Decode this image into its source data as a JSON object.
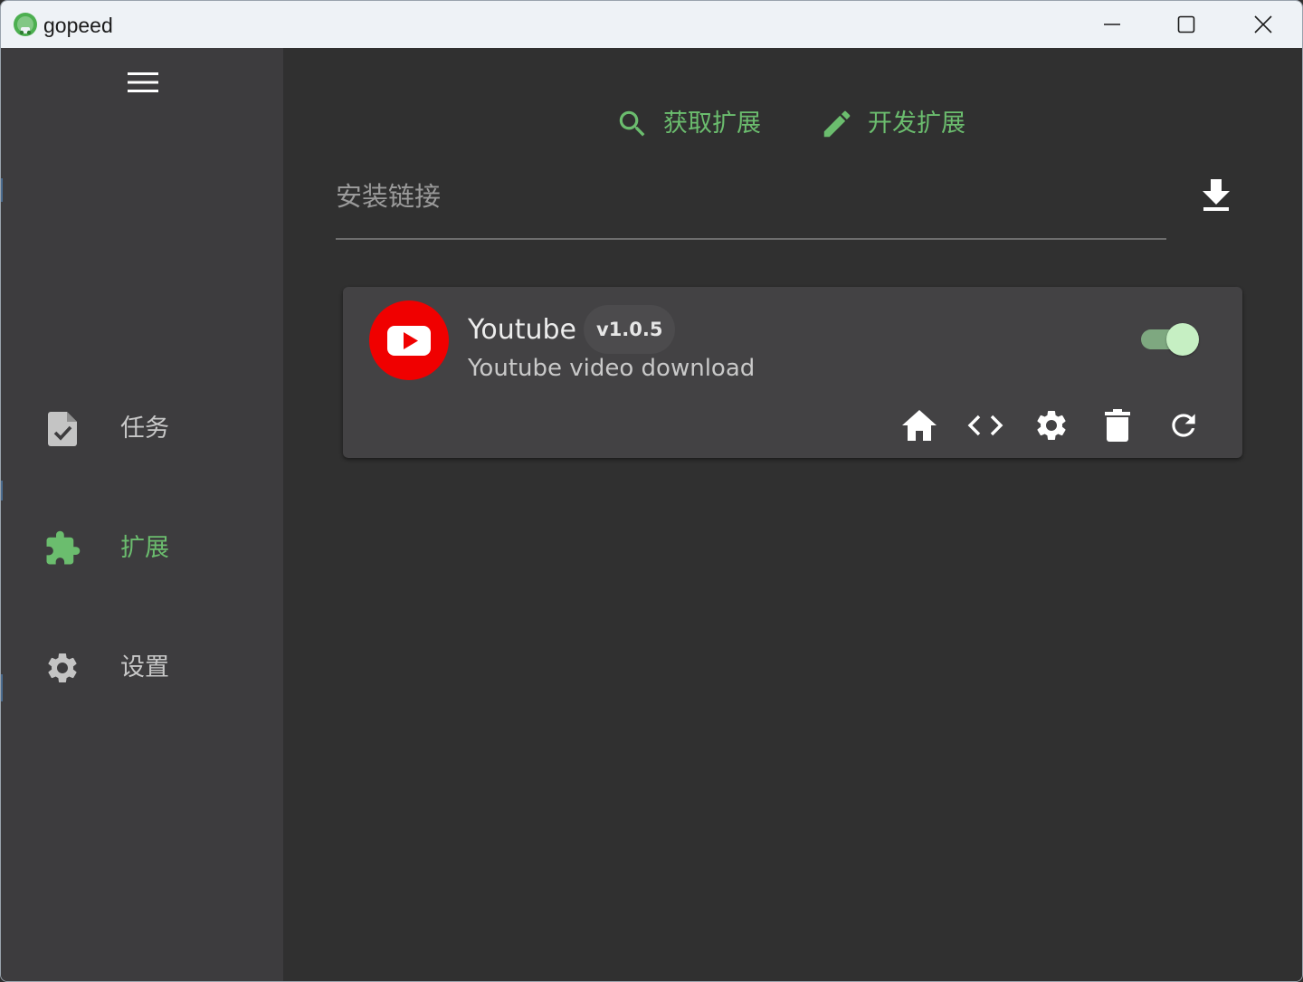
{
  "window": {
    "title": "gopeed",
    "logo_icon": "gopeed-logo-icon",
    "controls": [
      "minimize-icon",
      "maximize-icon",
      "close-icon"
    ]
  },
  "sidebar": {
    "menu_icon": "hamburger-menu-icon",
    "items": [
      {
        "label": "任务",
        "icon": "task-file-check-icon",
        "active": false
      },
      {
        "label": "扩展",
        "icon": "puzzle-extension-icon",
        "active": true
      },
      {
        "label": "设置",
        "icon": "gear-icon",
        "active": false
      }
    ]
  },
  "main": {
    "actions": [
      {
        "label": "获取扩展",
        "icon": "search-icon"
      },
      {
        "label": "开发扩展",
        "icon": "pencil-icon"
      }
    ],
    "install": {
      "placeholder": "安装链接",
      "value": "",
      "button_icon": "download-icon"
    },
    "extensions": [
      {
        "name": "Youtube",
        "version": "v1.0.5",
        "description": "Youtube video download",
        "icon": "youtube-logo-icon",
        "enabled": true,
        "actions": [
          "home-icon",
          "code-icon",
          "gear-icon",
          "trash-icon",
          "refresh-icon"
        ]
      }
    ]
  },
  "colors": {
    "accent": "#6bbd6e",
    "sidebar_bg": "#3d3c3e",
    "main_bg": "#303030",
    "card_bg": "#434244",
    "titlebar_bg": "#eef2f6",
    "youtube_red": "#f00000",
    "toggle_track": "#7ea880",
    "toggle_thumb": "#c6efc3"
  }
}
